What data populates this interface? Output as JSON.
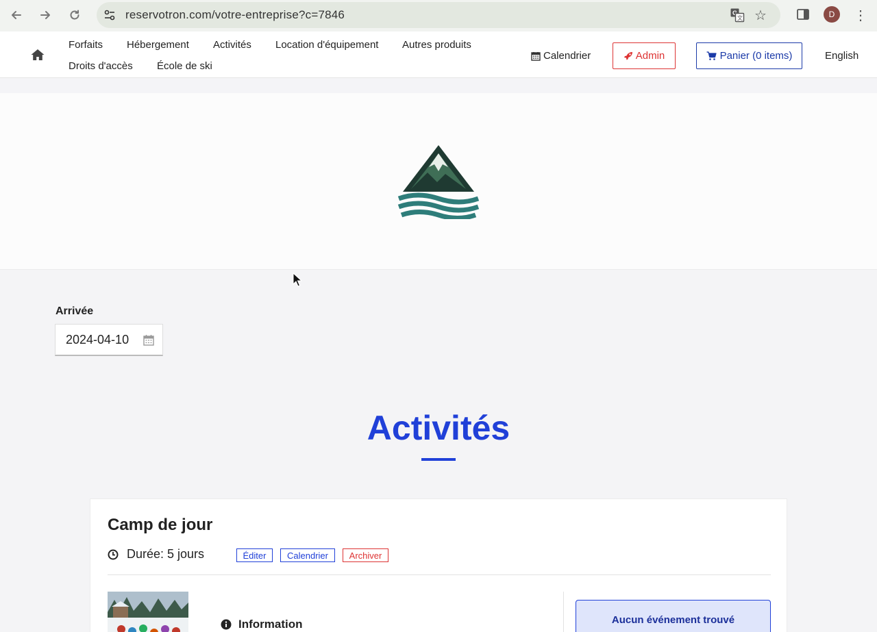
{
  "browser": {
    "url": "reservotron.com/votre-entreprise?c=7846",
    "avatar_letter": "D"
  },
  "nav": {
    "links_row1": [
      "Forfaits",
      "Hébergement",
      "Activités",
      "Location d'équipement",
      "Autres produits"
    ],
    "links_row2": [
      "Droits d'accès",
      "École de ski"
    ],
    "calendar_label": "Calendrier",
    "admin_label": "Admin",
    "cart_label": "Panier (0 items)",
    "language_label": "English"
  },
  "filter": {
    "arrival_label": "Arrivée",
    "arrival_value": "2024-04-10"
  },
  "section": {
    "title": "Activités"
  },
  "activity": {
    "title": "Camp de jour",
    "duration": "Durée: 5 jours",
    "edit_label": "Éditer",
    "calendar_label": "Calendrier",
    "archive_label": "Archiver",
    "info_label": "Information",
    "no_event_label": "Aucun événement trouvé"
  },
  "colors": {
    "accent": "#2040d8",
    "danger": "#dd3333",
    "logo_dark": "#1f3a32",
    "logo_teal": "#2e7d7a"
  }
}
